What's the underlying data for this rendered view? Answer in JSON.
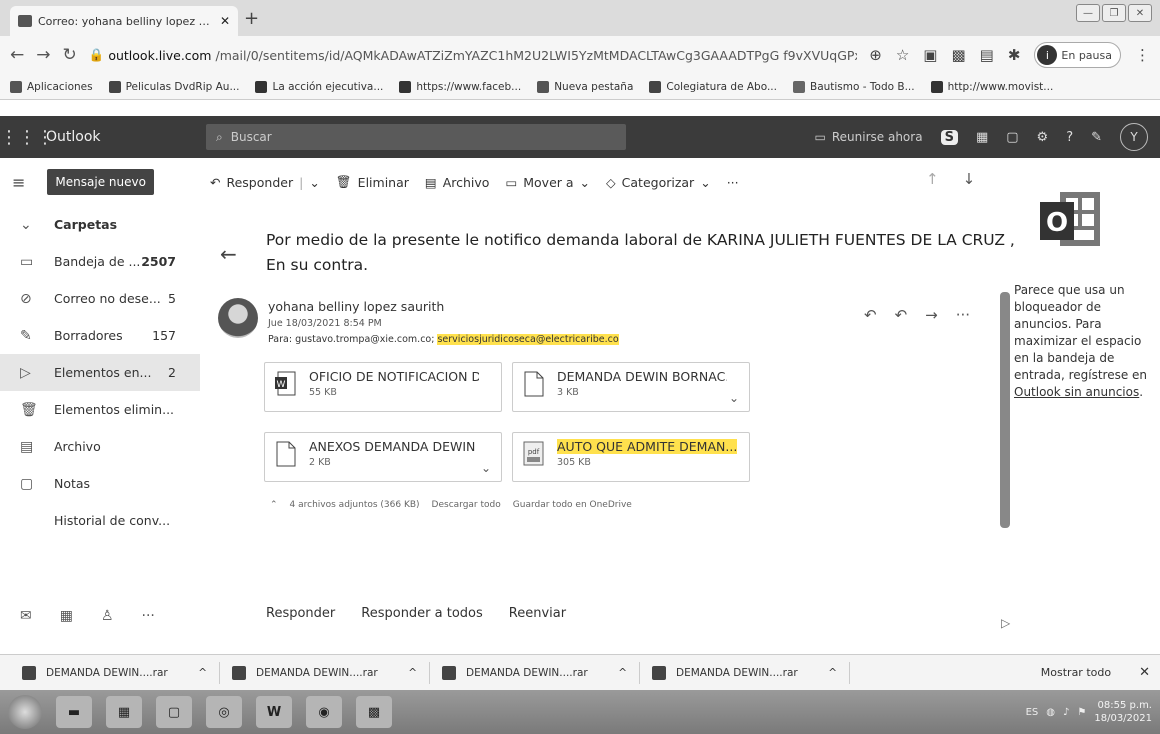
{
  "browser": {
    "tab_title": "Correo: yohana belliny lopez sau",
    "new_tab": "+",
    "url_domain": "outlook.live.com",
    "url_path": "/mail/0/sentitems/id/AQMkADAwATZiZmYAZC1hM2U2LWI5YzMtMDACLTAwCg3GAAADTPgG f9vXVUqGPxQC0...",
    "profile_initial": "i",
    "profile_status": "En pausa",
    "bookmarks": [
      {
        "label": "Aplicaciones",
        "color": "#555555"
      },
      {
        "label": "Peliculas DvdRip Au...",
        "color": "#444444"
      },
      {
        "label": "La acción ejecutiva...",
        "color": "#333333"
      },
      {
        "label": "https://www.faceb...",
        "color": "#333333"
      },
      {
        "label": "Nueva pestaña",
        "color": "#555555"
      },
      {
        "label": "Colegiatura de Abo...",
        "color": "#444444"
      },
      {
        "label": "Bautismo - Todo B...",
        "color": "#666666"
      },
      {
        "label": "http://www.movist...",
        "color": "#333333"
      }
    ]
  },
  "outlook": {
    "brand": "Outlook",
    "search_placeholder": "Buscar",
    "meet_now": "Reunirse ahora",
    "avatar_initial": "Y",
    "new_message": "Mensaje nuevo",
    "folders_header": "Carpetas",
    "folders": [
      {
        "label": "Bandeja de ...",
        "count": "2507",
        "icon": "inbox-icon",
        "bold": true
      },
      {
        "label": "Correo no dese...",
        "count": "5",
        "icon": "junk-icon"
      },
      {
        "label": "Borradores",
        "count": "157",
        "icon": "drafts-icon"
      },
      {
        "label": "Elementos en...",
        "count": "2",
        "icon": "sent-icon",
        "selected": true
      },
      {
        "label": "Elementos elimin...",
        "count": "",
        "icon": "trash-icon"
      },
      {
        "label": "Archivo",
        "count": "",
        "icon": "archive-icon"
      },
      {
        "label": "Notas",
        "count": "",
        "icon": "notes-icon"
      },
      {
        "label": "Historial de conv...",
        "count": "",
        "icon": ""
      }
    ],
    "commands": {
      "reply": "Responder",
      "delete": "Eliminar",
      "archive": "Archivo",
      "move": "Mover a",
      "categorize": "Categorizar",
      "more": "···"
    },
    "message": {
      "subject": "Por medio de la presente le notifico demanda laboral de KARINA JULIETH FUENTES DE LA CRUZ , En su contra.",
      "sender": "yohana belliny lopez saurith",
      "date": "Jue 18/03/2021 8:54 PM",
      "to_label": "Para:",
      "to_plain": "gustavo.trompa@xie.com.co;",
      "to_highlight": "serviciosjuridicoseca@electricaribe.co",
      "attachments": [
        {
          "name": "OFICIO DE NOTIFICACION D...",
          "size": "55 KB",
          "icon": "word-file-icon",
          "highlight": false
        },
        {
          "name": "DEMANDA DEWIN BORNAC...",
          "size": "3 KB",
          "icon": "file-icon",
          "highlight": false
        },
        {
          "name": "ANEXOS DEMANDA DEWIN ...",
          "size": "2 KB",
          "icon": "file-icon",
          "highlight": false
        },
        {
          "name": "AUTO QUE ADMITE DEMAN...",
          "size": "305 KB",
          "icon": "pdf-file-icon",
          "highlight": true
        }
      ],
      "attach_summary": "4 archivos adjuntos (366 KB)",
      "download_all": "Descargar todo",
      "save_onedrive": "Guardar todo en OneDrive"
    },
    "reply_bar": {
      "reply": "Responder",
      "reply_all": "Responder a todos",
      "forward": "Reenviar"
    },
    "ad": {
      "text": "Parece que usa un bloqueador de anuncios. Para maximizar el espacio en la bandeja de entrada, regístrese en",
      "link": "Outlook sin anuncios",
      "end": "."
    }
  },
  "downloads": {
    "items": [
      {
        "name": "DEMANDA DEWIN....rar"
      },
      {
        "name": "DEMANDA DEWIN....rar"
      },
      {
        "name": "DEMANDA DEWIN....rar"
      },
      {
        "name": "DEMANDA DEWIN....rar"
      }
    ],
    "show_all": "Mostrar todo"
  },
  "taskbar": {
    "language": "ES",
    "time": "08:55 p.m.",
    "date": "18/03/2021"
  },
  "colors": {
    "outlook_bar": "#3b3b3b",
    "highlight": "#ffe14d",
    "selected_folder": "#e6e6e6"
  }
}
